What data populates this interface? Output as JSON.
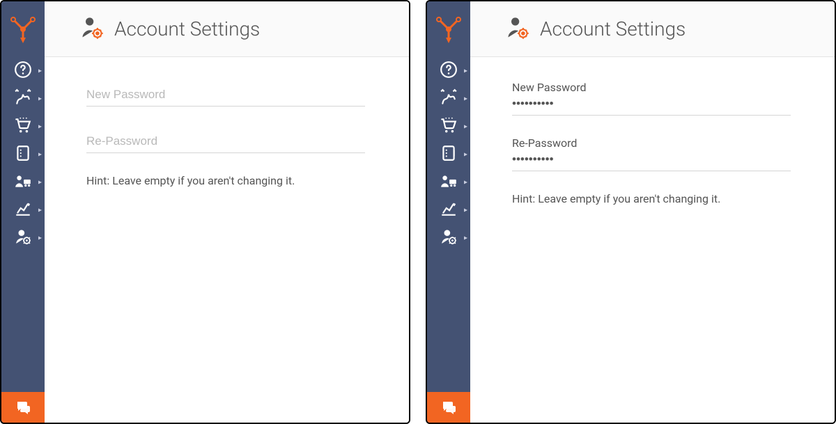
{
  "header": {
    "title": "Account Settings"
  },
  "panel_left": {
    "new_password_placeholder": "New Password",
    "re_password_placeholder": "Re-Password",
    "hint": "Hint: Leave empty if you aren't changing it."
  },
  "panel_right": {
    "new_password_label": "New Password",
    "new_password_value": "••••••••••",
    "re_password_label": "Re-Password",
    "re_password_value": "••••••••••",
    "hint": "Hint: Leave empty if you aren't changing it."
  }
}
